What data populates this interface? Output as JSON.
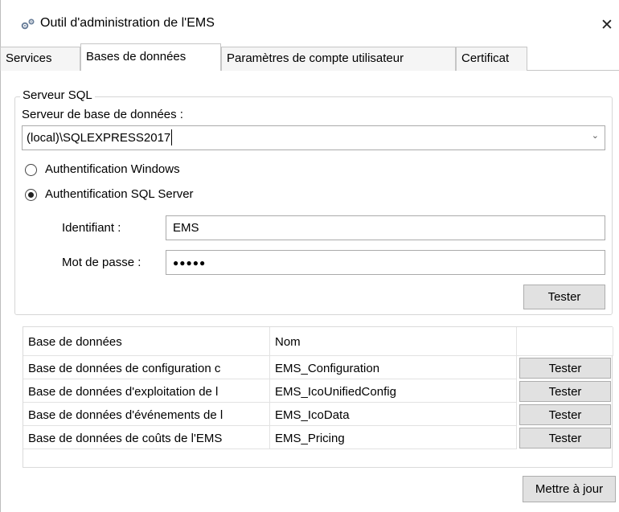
{
  "window": {
    "title": "Outil d'administration de l'EMS",
    "close": "✕"
  },
  "tabs": [
    {
      "label": "Services"
    },
    {
      "label": "Bases de données"
    },
    {
      "label": "Paramètres de compte utilisateur"
    },
    {
      "label": "Certificat"
    }
  ],
  "sql_server": {
    "group_title": "Serveur SQL",
    "server_label": "Serveur de base de données :",
    "server_value": "(local)\\SQLEXPRESS2017",
    "auth_windows": "Authentification Windows",
    "auth_sql": "Authentification SQL Server",
    "selected_auth": "sql",
    "login_label": "Identifiant :",
    "login_value": "EMS",
    "password_label": "Mot de passe :",
    "password_value": "●●●●●",
    "test_button": "Tester"
  },
  "databases": {
    "headers": [
      "Base de données",
      "Nom",
      ""
    ],
    "rows": [
      {
        "database": "Base de données de configuration c",
        "name": "EMS_Configuration",
        "action": "Tester"
      },
      {
        "database": "Base de données d'exploitation de l",
        "name": "EMS_IcoUnifiedConfig",
        "action": "Tester"
      },
      {
        "database": "Base de données d'événements de l",
        "name": "EMS_IcoData",
        "action": "Tester"
      },
      {
        "database": "Base de données de coûts de l'EMS",
        "name": "EMS_Pricing",
        "action": "Tester"
      }
    ]
  },
  "footer": {
    "update_button": "Mettre à jour"
  }
}
